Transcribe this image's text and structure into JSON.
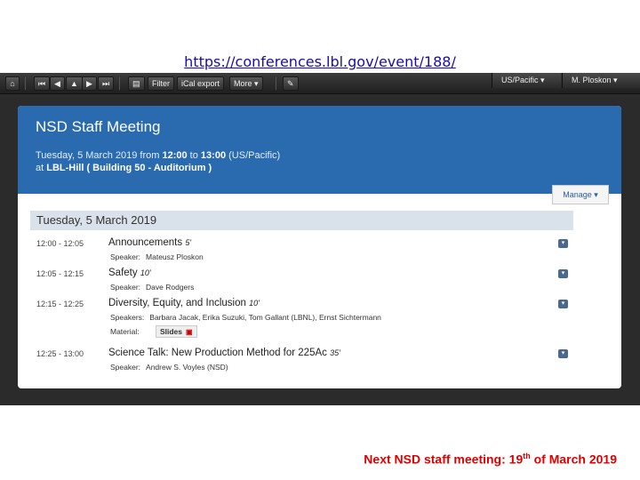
{
  "url": "https://conferences.lbl.gov/event/188/",
  "toolbar": {
    "filter": "Filter",
    "ical": "iCal export",
    "more": "More ▾",
    "timezone": "US/Pacific ▾",
    "user": "M. Ploskon ▾"
  },
  "event": {
    "title": "NSD Staff Meeting",
    "date_prefix": "Tuesday, 5 March 2019 from",
    "start": "12:00",
    "to": "to",
    "end": "13:00",
    "tz": "(US/Pacific)",
    "at": "at",
    "location": "LBL-Hill ( Building 50 - Auditorium )",
    "manage": "Manage ▾"
  },
  "day_header": "Tuesday, 5 March 2019",
  "items": [
    {
      "time": "12:00 - 12:05",
      "title": "Announcements",
      "duration": "5'",
      "label": "Speaker:",
      "people": "Mateusz Ploskon"
    },
    {
      "time": "12:05 - 12:15",
      "title": "Safety",
      "duration": "10'",
      "label": "Speaker:",
      "people": "Dave Rodgers"
    },
    {
      "time": "12:15 - 12:25",
      "title": "Diversity, Equity, and Inclusion",
      "duration": "10'",
      "label": "Speakers:",
      "people": "Barbara Jacak, Erika Suzuki, Tom Gallant (LBNL), Ernst Sichtermann",
      "material_label": "Material:",
      "material": "Slides"
    },
    {
      "time": "12:25 - 13:00",
      "title": "Science Talk: New Production Method for 225Ac",
      "duration": "35'",
      "label": "Speaker:",
      "people": "Andrew S. Voyles (NSD)"
    }
  ],
  "footer": {
    "prefix": "Next NSD staff meeting: 19",
    "sup": "th",
    "suffix": " of March 2019"
  }
}
